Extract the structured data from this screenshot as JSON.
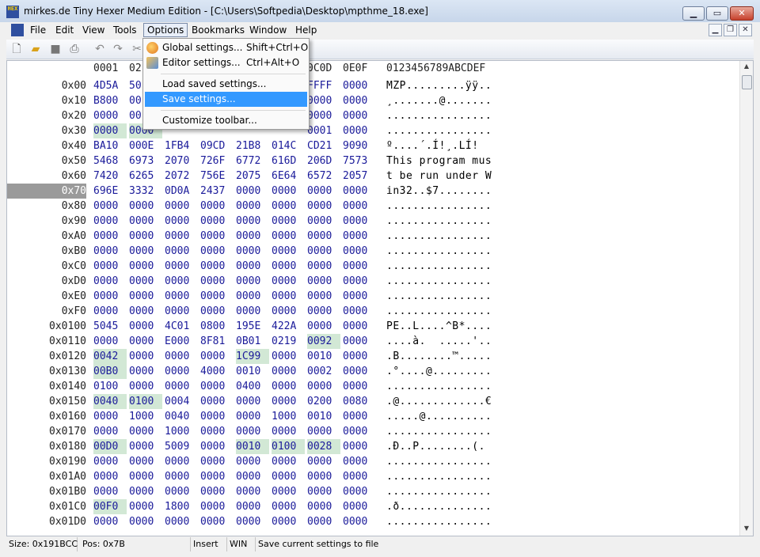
{
  "window": {
    "title": "mirkes.de Tiny Hexer Medium Edition - [C:\\Users\\Softpedia\\Desktop\\mpthme_18.exe]",
    "icon_label": "HEX"
  },
  "menubar": {
    "items": [
      "File",
      "Edit",
      "View",
      "Tools",
      "Options",
      "Bookmarks",
      "Window",
      "Help"
    ],
    "active": "Options"
  },
  "options_menu": {
    "items": [
      {
        "label": "Global settings...",
        "shortcut": "Shift+Ctrl+O",
        "icon": "globe-settings-icon"
      },
      {
        "label": "Editor settings...",
        "shortcut": "Ctrl+Alt+O",
        "icon": "editor-settings-icon"
      },
      {
        "label": "Load saved settings...",
        "shortcut": ""
      },
      {
        "label": "Save settings...",
        "shortcut": ""
      },
      {
        "label": "Customize toolbar...",
        "shortcut": ""
      }
    ],
    "highlighted": "Save settings..."
  },
  "toolbar": {
    "buttons": [
      "new-file-icon",
      "open-folder-icon",
      "save-icon",
      "print-icon",
      "undo-icon",
      "redo-icon",
      "cut-icon"
    ]
  },
  "hex_header": {
    "columns": [
      "0001",
      "02",
      "0C0D",
      "0E0F"
    ],
    "ascii_header": "0123456789ABCDEF"
  },
  "hex_rows": [
    {
      "addr": "0x00",
      "groups": [
        "4D5A",
        "50",
        "",
        "",
        "",
        "",
        "FFFF",
        "0000"
      ],
      "ascii": "MZP.........ÿÿ.."
    },
    {
      "addr": "0x10",
      "groups": [
        "B800",
        "00",
        "",
        "",
        "",
        "",
        "0000",
        "0000"
      ],
      "ascii": "¸.......@......."
    },
    {
      "addr": "0x20",
      "groups": [
        "0000",
        "00",
        "",
        "",
        "",
        "",
        "0000",
        "0000"
      ],
      "ascii": "................"
    },
    {
      "addr": "0x30",
      "groups": [
        "0000",
        "0000",
        "",
        "",
        "",
        "",
        "0001",
        "0000"
      ],
      "ascii": "................"
    },
    {
      "addr": "0x40",
      "groups": [
        "BA10",
        "000E",
        "1FB4",
        "09CD",
        "21B8",
        "014C",
        "CD21",
        "9090"
      ],
      "ascii": "º....´.Í!¸.LÍ!"
    },
    {
      "addr": "0x50",
      "groups": [
        "5468",
        "6973",
        "2070",
        "726F",
        "6772",
        "616D",
        "206D",
        "7573"
      ],
      "ascii": "This program mus"
    },
    {
      "addr": "0x60",
      "groups": [
        "7420",
        "6265",
        "2072",
        "756E",
        "2075",
        "6E64",
        "6572",
        "2057"
      ],
      "ascii": "t be run under W"
    },
    {
      "addr": "0x70",
      "groups": [
        "696E",
        "3332",
        "0D0A",
        "2437",
        "0000",
        "0000",
        "0000",
        "0000"
      ],
      "ascii": "in32..$7........"
    },
    {
      "addr": "0x80",
      "groups": [
        "0000",
        "0000",
        "0000",
        "0000",
        "0000",
        "0000",
        "0000",
        "0000"
      ],
      "ascii": "................"
    },
    {
      "addr": "0x90",
      "groups": [
        "0000",
        "0000",
        "0000",
        "0000",
        "0000",
        "0000",
        "0000",
        "0000"
      ],
      "ascii": "................"
    },
    {
      "addr": "0xA0",
      "groups": [
        "0000",
        "0000",
        "0000",
        "0000",
        "0000",
        "0000",
        "0000",
        "0000"
      ],
      "ascii": "................"
    },
    {
      "addr": "0xB0",
      "groups": [
        "0000",
        "0000",
        "0000",
        "0000",
        "0000",
        "0000",
        "0000",
        "0000"
      ],
      "ascii": "................"
    },
    {
      "addr": "0xC0",
      "groups": [
        "0000",
        "0000",
        "0000",
        "0000",
        "0000",
        "0000",
        "0000",
        "0000"
      ],
      "ascii": "................"
    },
    {
      "addr": "0xD0",
      "groups": [
        "0000",
        "0000",
        "0000",
        "0000",
        "0000",
        "0000",
        "0000",
        "0000"
      ],
      "ascii": "................"
    },
    {
      "addr": "0xE0",
      "groups": [
        "0000",
        "0000",
        "0000",
        "0000",
        "0000",
        "0000",
        "0000",
        "0000"
      ],
      "ascii": "................"
    },
    {
      "addr": "0xF0",
      "groups": [
        "0000",
        "0000",
        "0000",
        "0000",
        "0000",
        "0000",
        "0000",
        "0000"
      ],
      "ascii": "................"
    },
    {
      "addr": "0x0100",
      "groups": [
        "5045",
        "0000",
        "4C01",
        "0800",
        "195E",
        "422A",
        "0000",
        "0000"
      ],
      "ascii": "PE..L....^B*...."
    },
    {
      "addr": "0x0110",
      "groups": [
        "0000",
        "0000",
        "E000",
        "8F81",
        "0B01",
        "0219",
        "0092",
        "0000"
      ],
      "ascii": "....à.  .....'.."
    },
    {
      "addr": "0x0120",
      "groups": [
        "0042",
        "0000",
        "0000",
        "0000",
        "1C99",
        "0000",
        "0010",
        "0000"
      ],
      "ascii": ".B........™....."
    },
    {
      "addr": "0x0130",
      "groups": [
        "00B0",
        "0000",
        "0000",
        "4000",
        "0010",
        "0000",
        "0002",
        "0000"
      ],
      "ascii": ".°....@........."
    },
    {
      "addr": "0x0140",
      "groups": [
        "0100",
        "0000",
        "0000",
        "0000",
        "0400",
        "0000",
        "0000",
        "0000"
      ],
      "ascii": "................"
    },
    {
      "addr": "0x0150",
      "groups": [
        "0040",
        "0100",
        "0004",
        "0000",
        "0000",
        "0000",
        "0200",
        "0080"
      ],
      "ascii": ".@.............€"
    },
    {
      "addr": "0x0160",
      "groups": [
        "0000",
        "1000",
        "0040",
        "0000",
        "0000",
        "1000",
        "0010",
        "0000"
      ],
      "ascii": ".....@.........."
    },
    {
      "addr": "0x0170",
      "groups": [
        "0000",
        "0000",
        "1000",
        "0000",
        "0000",
        "0000",
        "0000",
        "0000"
      ],
      "ascii": "................"
    },
    {
      "addr": "0x0180",
      "groups": [
        "00D0",
        "0000",
        "5009",
        "0000",
        "0010",
        "0100",
        "0028",
        "0000"
      ],
      "ascii": ".Ð..P........(."
    },
    {
      "addr": "0x0190",
      "groups": [
        "0000",
        "0000",
        "0000",
        "0000",
        "0000",
        "0000",
        "0000",
        "0000"
      ],
      "ascii": "................"
    },
    {
      "addr": "0x01A0",
      "groups": [
        "0000",
        "0000",
        "0000",
        "0000",
        "0000",
        "0000",
        "0000",
        "0000"
      ],
      "ascii": "................"
    },
    {
      "addr": "0x01B0",
      "groups": [
        "0000",
        "0000",
        "0000",
        "0000",
        "0000",
        "0000",
        "0000",
        "0000"
      ],
      "ascii": "................"
    },
    {
      "addr": "0x01C0",
      "groups": [
        "00F0",
        "0000",
        "1800",
        "0000",
        "0000",
        "0000",
        "0000",
        "0000"
      ],
      "ascii": ".ð.............."
    },
    {
      "addr": "0x01D0",
      "groups": [
        "0000",
        "0000",
        "0000",
        "0000",
        "0000",
        "0000",
        "0000",
        "0000"
      ],
      "ascii": "................"
    }
  ],
  "highlighted_row": "0x70",
  "statusbar": {
    "size": "Size: 0x191BCC",
    "pos": "Pos: 0x7B",
    "mode": "Insert",
    "encoding": "WIN",
    "message": "Save current settings to file"
  },
  "colors": {
    "hex_text": "#1a1a9a",
    "highlight_bg": "#d2e8d5",
    "menu_hover": "#3399ff",
    "address_selected_bg": "#9a9a9a"
  }
}
